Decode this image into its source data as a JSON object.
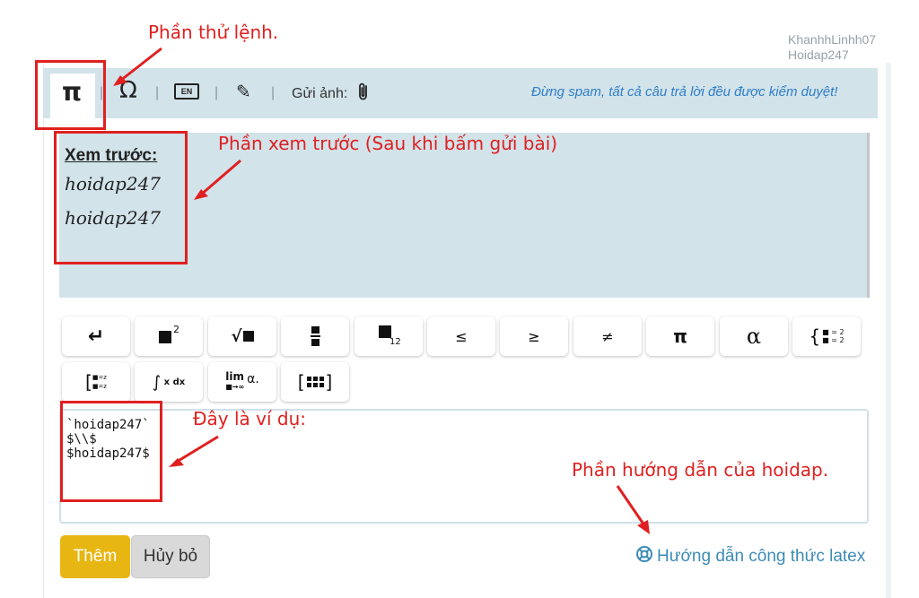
{
  "annotations": {
    "command_area": "Phần thử lệnh.",
    "preview_area": "Phần xem trước (Sau khi bấm gửi bài)",
    "example": "Đây là ví dụ:",
    "guide": "Phần hướng dẫn của hoidap."
  },
  "watermark": {
    "line1": "KhanhhLinhh07",
    "line2": "Hoidap247"
  },
  "toolbar": {
    "tabs": [
      "π",
      "Ω",
      "EN",
      "✎",
      "Gửi ảnh:"
    ],
    "send_image_label": "Gửi ảnh:",
    "notice": "Đừng spam, tất cả câu trả lời đều được kiểm duyệt!"
  },
  "preview": {
    "title": "Xem trước:",
    "lines": [
      "hoidap247",
      "hoidap247"
    ]
  },
  "math_buttons": {
    "row1": [
      "↵",
      "x²",
      "√",
      "frac",
      "x₁₂",
      "≤",
      "≥",
      "≠",
      "π",
      "α",
      "{ cases"
    ],
    "row2": [
      "matrix",
      "∫ x dx",
      "lim",
      "[ grid ]"
    ]
  },
  "editor": {
    "lines": [
      "`hoidap247`",
      "$\\\\$",
      "$hoidap247$"
    ]
  },
  "actions": {
    "add": "Thêm",
    "cancel": "Hủy bỏ",
    "guide_link": "Hướng dẫn công thức latex"
  },
  "colors": {
    "annotation_red": "#e02020",
    "toolbar_bg": "#d2e3ea",
    "add_button": "#e8b612",
    "link_blue": "#3d8bb5"
  }
}
